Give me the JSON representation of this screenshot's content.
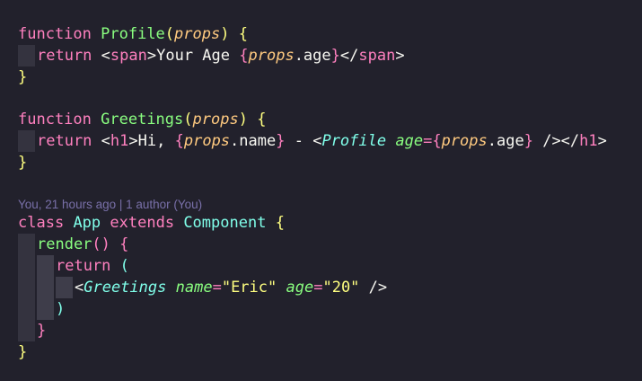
{
  "editor": {
    "codelens_blame": "You, 21 hours ago | 1 author (You)",
    "tokens": {
      "function": "function",
      "return": "return",
      "class": "class",
      "extends": "extends",
      "profile": "Profile",
      "greetings": "Greetings",
      "props": "props",
      "app": "App",
      "component": "Component",
      "render": "render",
      "span": "span",
      "h1": "h1",
      "your_age": "Your Age ",
      "hi": "Hi, ",
      "dash": " - ",
      "age_attr": "age",
      "name_attr": "name",
      "dot_age": ".age",
      "dot_name": ".name",
      "eric": "\"Eric\"",
      "twenty": "\"20\""
    }
  },
  "colors": {
    "background": "#22212c",
    "keyword": "#ff80bf",
    "function_name": "#8aff80",
    "class_name": "#80ffea",
    "parameter": "#ffca80",
    "string": "#ffff80",
    "codelens": "#7970a9"
  }
}
